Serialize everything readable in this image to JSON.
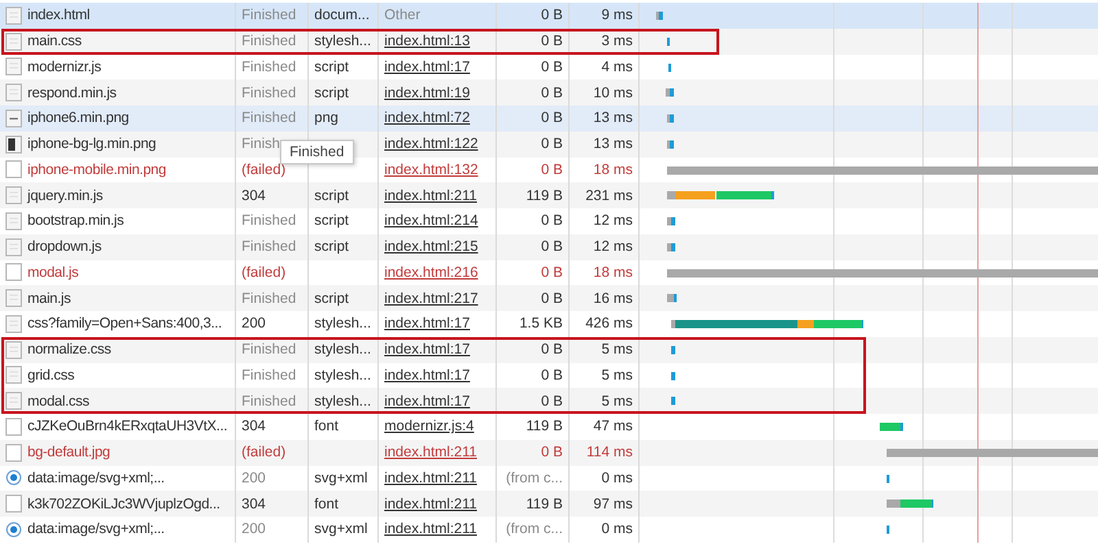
{
  "requests": [
    {
      "name": "index.html",
      "status": "Finished",
      "type": "docum...",
      "initiator": "Other",
      "size": "0 B",
      "time": "9 ms",
      "kind": "file",
      "failed": false,
      "selected": true,
      "hovered": false,
      "boxed": false,
      "cached": false
    },
    {
      "name": "main.css",
      "status": "Finished",
      "type": "stylesh...",
      "initiator": "index.html:13",
      "size": "0 B",
      "time": "3 ms",
      "kind": "file",
      "failed": false,
      "selected": false,
      "hovered": false,
      "boxed": true,
      "cached": false
    },
    {
      "name": "modernizr.js",
      "status": "Finished",
      "type": "script",
      "initiator": "index.html:17",
      "size": "0 B",
      "time": "4 ms",
      "kind": "file",
      "failed": false,
      "selected": false,
      "hovered": false,
      "boxed": false,
      "cached": false
    },
    {
      "name": "respond.min.js",
      "status": "Finished",
      "type": "script",
      "initiator": "index.html:19",
      "size": "0 B",
      "time": "10 ms",
      "kind": "file",
      "failed": false,
      "selected": false,
      "hovered": false,
      "boxed": false,
      "cached": false
    },
    {
      "name": "iphone6.min.png",
      "status": "Finished",
      "type": "png",
      "initiator": "index.html:72",
      "size": "0 B",
      "time": "13 ms",
      "kind": "image",
      "failed": false,
      "selected": false,
      "hovered": true,
      "boxed": false,
      "cached": false
    },
    {
      "name": "iphone-bg-lg.min.png",
      "status": "Finish",
      "initiator": "index.html:122",
      "size": "0 B",
      "time": "13 ms",
      "kind": "dark-image",
      "failed": false,
      "selected": false,
      "hovered": false,
      "boxed": false,
      "cached": false
    },
    {
      "name": "iphone-mobile.min.png",
      "status": "(failed)",
      "initiator": "index.html:132",
      "size": "0 B",
      "time": "18 ms",
      "kind": "blank",
      "failed": true,
      "selected": false,
      "hovered": false,
      "boxed": false,
      "cached": false
    },
    {
      "name": "jquery.min.js",
      "status": "304",
      "type": "script",
      "initiator": "index.html:211",
      "size": "119 B",
      "time": "231 ms",
      "kind": "file",
      "failed": false,
      "selected": false,
      "hovered": false,
      "boxed": false,
      "cached": false
    },
    {
      "name": "bootstrap.min.js",
      "status": "Finished",
      "type": "script",
      "initiator": "index.html:214",
      "size": "0 B",
      "time": "12 ms",
      "kind": "file",
      "failed": false,
      "selected": false,
      "hovered": false,
      "boxed": false,
      "cached": false
    },
    {
      "name": "dropdown.js",
      "status": "Finished",
      "type": "script",
      "initiator": "index.html:215",
      "size": "0 B",
      "time": "12 ms",
      "kind": "file",
      "failed": false,
      "selected": false,
      "hovered": false,
      "boxed": false,
      "cached": false
    },
    {
      "name": "modal.js",
      "status": "(failed)",
      "initiator": "index.html:216",
      "size": "0 B",
      "time": "18 ms",
      "kind": "blank",
      "failed": true,
      "selected": false,
      "hovered": false,
      "boxed": false,
      "cached": false
    },
    {
      "name": "main.js",
      "status": "Finished",
      "type": "script",
      "initiator": "index.html:217",
      "size": "0 B",
      "time": "16 ms",
      "kind": "file",
      "failed": false,
      "selected": false,
      "hovered": false,
      "boxed": false,
      "cached": false
    },
    {
      "name": "css?family=Open+Sans:400,3...",
      "status": "200",
      "type": "stylesh...",
      "initiator": "index.html:17",
      "size": "1.5 KB",
      "time": "426 ms",
      "kind": "file",
      "failed": false,
      "selected": false,
      "hovered": false,
      "boxed": false,
      "cached": false
    },
    {
      "name": "normalize.css",
      "status": "Finished",
      "type": "stylesh...",
      "initiator": "index.html:17",
      "size": "0 B",
      "time": "5 ms",
      "kind": "file",
      "failed": false,
      "selected": false,
      "hovered": false,
      "boxed": true,
      "cached": false
    },
    {
      "name": "grid.css",
      "status": "Finished",
      "type": "stylesh...",
      "initiator": "index.html:17",
      "size": "0 B",
      "time": "5 ms",
      "kind": "file",
      "failed": false,
      "selected": false,
      "hovered": false,
      "boxed": true,
      "cached": false
    },
    {
      "name": "modal.css",
      "status": "Finished",
      "type": "stylesh...",
      "initiator": "index.html:17",
      "size": "0 B",
      "time": "5 ms",
      "kind": "file",
      "failed": false,
      "selected": false,
      "hovered": false,
      "boxed": true,
      "cached": false
    },
    {
      "name": "cJZKeOuBrn4kERxqtaUH3VtX...",
      "status": "304",
      "type": "font",
      "initiator": "modernizr.js:4",
      "size": "119 B",
      "time": "47 ms",
      "kind": "blank",
      "failed": false,
      "selected": false,
      "hovered": false,
      "boxed": false,
      "cached": false
    },
    {
      "name": "bg-default.jpg",
      "status": "(failed)",
      "initiator": "index.html:211",
      "size": "0 B",
      "time": "114 ms",
      "kind": "blank",
      "failed": true,
      "selected": false,
      "hovered": false,
      "boxed": false,
      "cached": false
    },
    {
      "name": "data:image/svg+xml;...",
      "status": "200",
      "type": "svg+xml",
      "initiator": "index.html:211",
      "size": "(from c...",
      "time": "0 ms",
      "kind": "data",
      "failed": false,
      "selected": false,
      "hovered": false,
      "boxed": false,
      "cached": true
    },
    {
      "name": "k3k702ZOKiLJc3WVjuplzOgd...",
      "status": "304",
      "type": "font",
      "initiator": "index.html:211",
      "size": "119 B",
      "time": "97 ms",
      "kind": "blank",
      "failed": false,
      "selected": false,
      "hovered": false,
      "boxed": false,
      "cached": false
    },
    {
      "name": "data:image/svg+xml;...",
      "status": "200",
      "type": "svg+xml",
      "initiator": "index.html:211",
      "size": "(from c...",
      "time": "0 ms",
      "kind": "data",
      "failed": false,
      "selected": false,
      "hovered": false,
      "boxed": false,
      "cached": true
    }
  ],
  "tooltip": {
    "text": "Finished"
  }
}
